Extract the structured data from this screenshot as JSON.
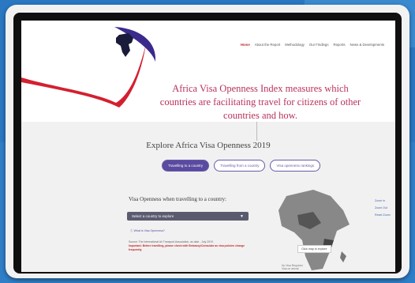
{
  "nav": {
    "items": [
      {
        "label": "Home",
        "active": true
      },
      {
        "label": "About the Report",
        "active": false
      },
      {
        "label": "Methodology",
        "active": false
      },
      {
        "label": "Our Findings",
        "active": false
      },
      {
        "label": "Reports",
        "active": false
      },
      {
        "label": "News & Developments",
        "active": false
      }
    ]
  },
  "hero": {
    "headline": "Africa Visa Openness Index measures which countries are facilitating travel for citizens of other countries and how."
  },
  "explore": {
    "title": "Explore Africa Visa Openness 2019",
    "tabs": [
      {
        "label": "Travelling to a country",
        "selected": true
      },
      {
        "label": "Travelling from a country",
        "selected": false
      },
      {
        "label": "Visa openness rankings",
        "selected": false
      }
    ]
  },
  "panel": {
    "title": "Visa Openness when travelling to a country:",
    "select_label": "Select a country to explore",
    "what_is": "What is Visa Openness?",
    "source": "Source: The International Air Transport Association, as date - July 2019.",
    "important": "Important: Before travelling, please check with Embassy/Consulate as visa policies change frequently."
  },
  "map": {
    "tooltip": "Click map to explore",
    "zoom": [
      "Zoom in",
      "Zoom Out",
      "Reset Zoom"
    ],
    "legend": [
      "No Visa Required",
      "Visa on arrival"
    ]
  },
  "colors": {
    "accent": "#5a4aa0",
    "headline": "#b8325a",
    "brand_red": "#c62828"
  }
}
